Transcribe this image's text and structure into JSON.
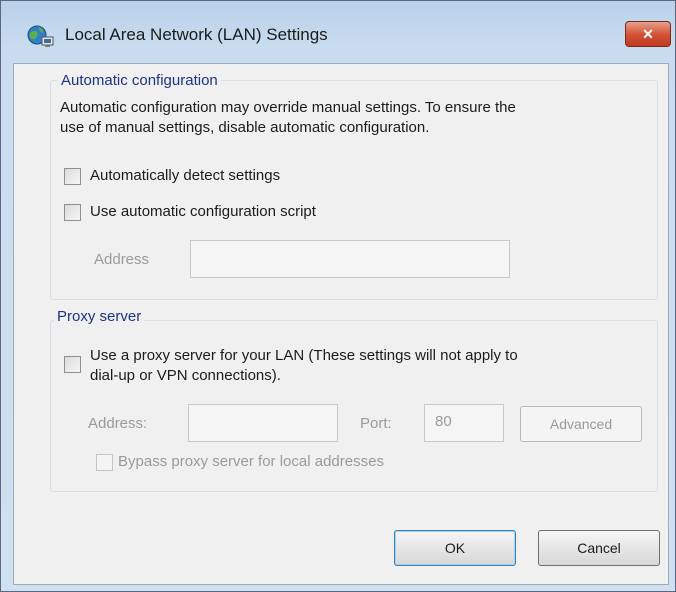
{
  "window": {
    "title": "Local Area Network (LAN) Settings",
    "close_glyph": "✕"
  },
  "auto_config": {
    "group_label": "Automatic configuration",
    "description_line1": "Automatic configuration may override manual settings.  To ensure the",
    "description_line2": "use of manual settings, disable automatic configuration.",
    "detect_label": "Automatically detect settings",
    "detect_checked": false,
    "script_label": "Use automatic configuration script",
    "script_checked": false,
    "address_label": "Address",
    "address_value": ""
  },
  "proxy": {
    "group_label": "Proxy server",
    "use_proxy_line1": "Use a proxy server for your LAN (These settings will not apply to",
    "use_proxy_line2": "dial-up or VPN connections).",
    "use_proxy_checked": false,
    "address_label": "Address:",
    "address_value": "",
    "port_label": "Port:",
    "port_value": "80",
    "advanced_label": "Advanced",
    "bypass_label": "Bypass proxy server for local addresses",
    "bypass_checked": false
  },
  "buttons": {
    "ok_label": "OK",
    "cancel_label": "Cancel"
  },
  "colors": {
    "titlebar": "#c9dcef",
    "close_button": "#c3381e",
    "group_label": "#1e3287"
  }
}
